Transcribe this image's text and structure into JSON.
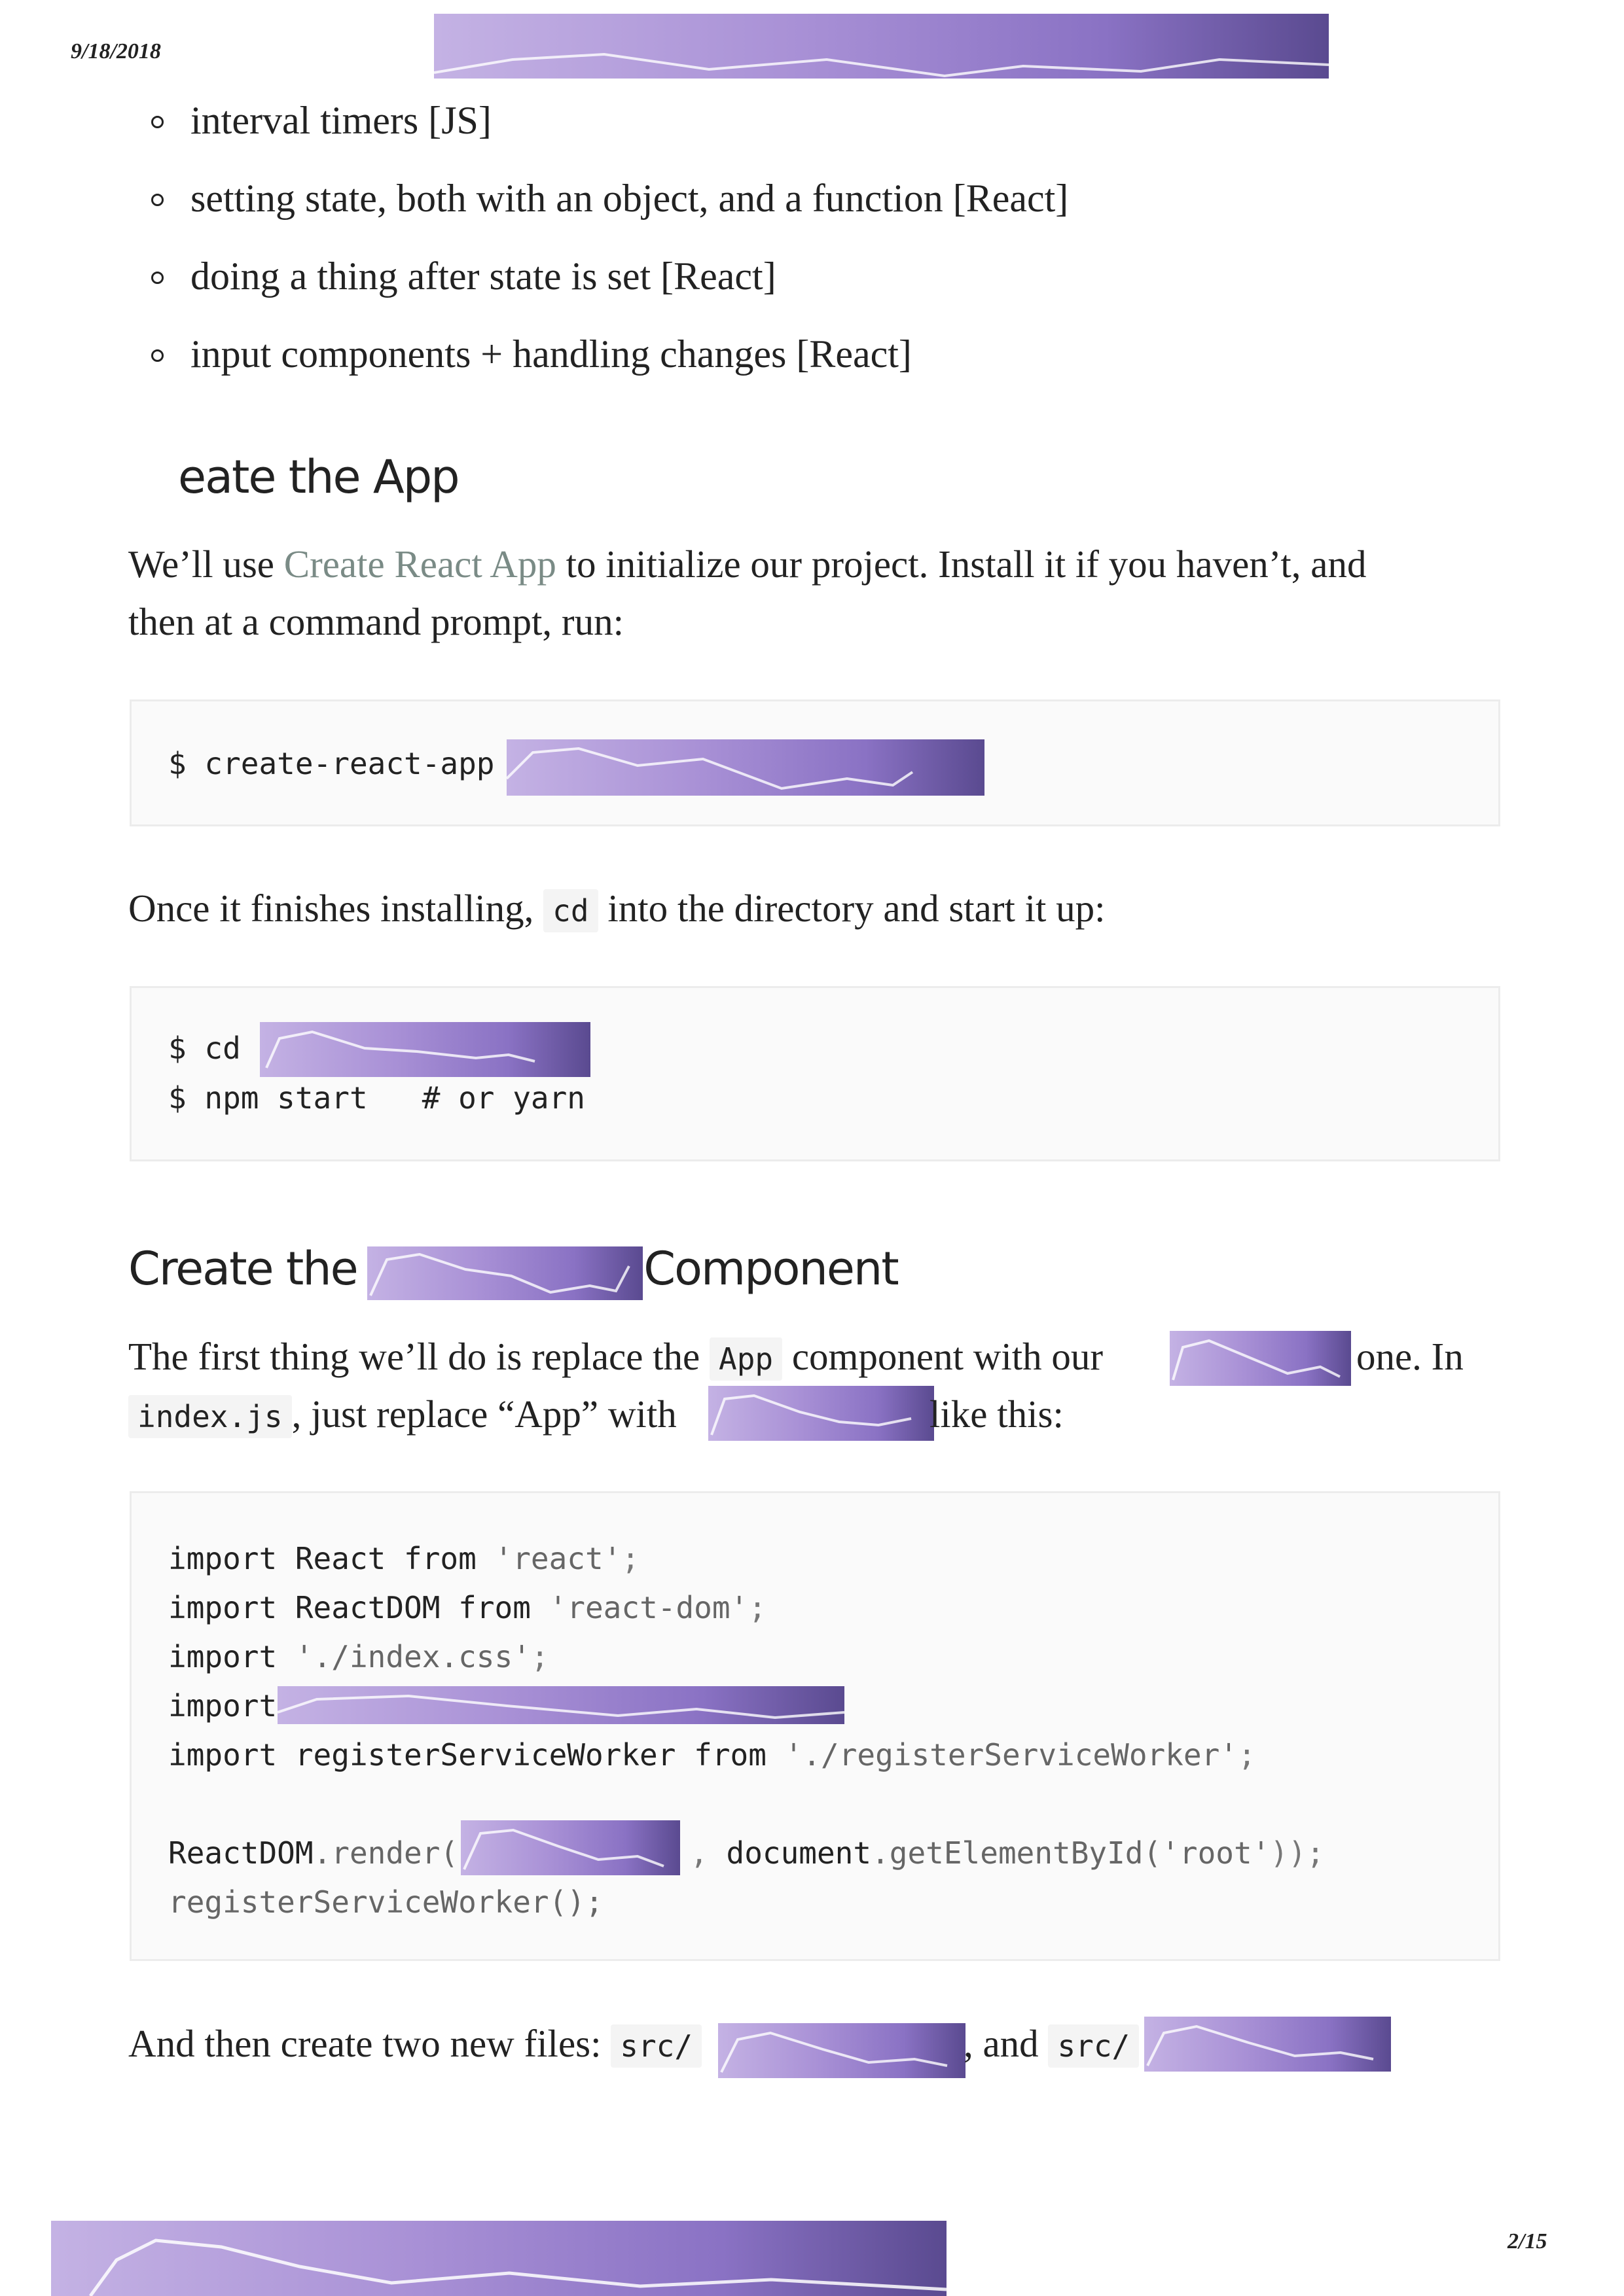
{
  "header": {
    "date": "9/18/2018"
  },
  "footer": {
    "page": "2/15"
  },
  "bullets": [
    "interval timers [JS]",
    "setting state, both with an object, and a function [React]",
    "doing a thing after state is set [React]",
    "input components + handling changes [React]"
  ],
  "section1": {
    "heading": "eate the App",
    "p1_before": "We’ll use ",
    "p1_link": "Create React App",
    "p1_after": " to initialize our project. Install it if you haven’t, and",
    "p1_line2": "then at a command prompt, run:"
  },
  "code1": {
    "prompt": "$ create-react-app "
  },
  "p2": {
    "before": "Once it finishes installing, ",
    "code": "cd",
    "after": " into the directory and start it up:"
  },
  "code2": {
    "line1": "$ cd ",
    "line2": "$ npm start   # or yarn"
  },
  "section2": {
    "heading_before": "Create the ",
    "heading_after": "e Component",
    "p1_before": "The first thing we’ll do is replace the ",
    "p1_code": "App",
    "p1_mid": " component with our ",
    "p1_after": " one. In",
    "p2_code": "index.js",
    "p2_mid": ", just replace “App” with ",
    "p2_after": " like this:"
  },
  "code3": {
    "l1_kw": "import",
    "l1_name": " React ",
    "l1_from": "from",
    "l1_str": " 'react'",
    "l1_end": ";",
    "l2_kw": "import",
    "l2_name": " ReactDOM ",
    "l2_from": "from",
    "l2_str": " 'react-dom'",
    "l2_end": ";",
    "l3_kw": "import",
    "l3_str": " './index.css'",
    "l3_end": ";",
    "l4_kw": "import",
    "l5_kw": "import",
    "l5_name": " registerServiceWorker ",
    "l5_from": "from",
    "l5_str": " './registerServiceWorker'",
    "l5_end": ";",
    "l6_a": "ReactDOM",
    "l6_b": ".render(",
    "l6_c": ", ",
    "l6_d": "document",
    "l6_e": ".getElementById(",
    "l6_f": "'root'",
    "l6_g": "));",
    "l7": "registerServiceWorker();"
  },
  "p3": {
    "before": "And then create two new files: ",
    "code1": "src/",
    "mid": ", and ",
    "code2": "src/"
  }
}
